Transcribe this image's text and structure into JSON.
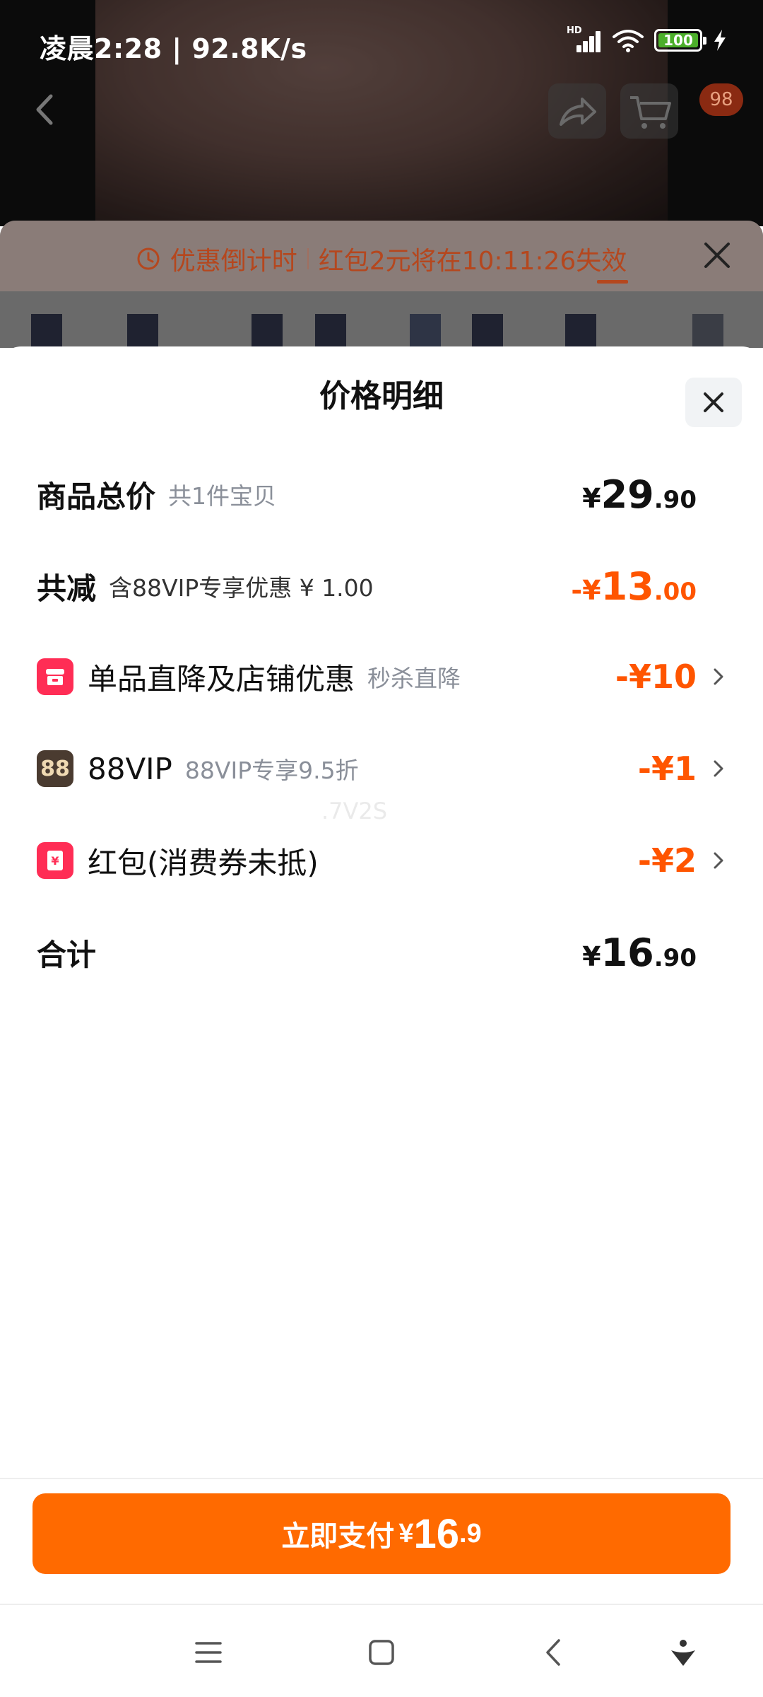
{
  "status_bar": {
    "time": "凌晨2:28 | 92.8K/s",
    "battery": "100",
    "signal_label": "HD"
  },
  "header": {
    "cart_badge": "98"
  },
  "promo": {
    "countdown_label": "优惠倒计时",
    "message": "红包2元将在10:11:26失效"
  },
  "sheet": {
    "title": "价格明细",
    "rows": [
      {
        "label": "商品总价",
        "sub": "共1件宝贝",
        "currency": "¥",
        "int": "29",
        "dec": ".90"
      },
      {
        "label": "共减",
        "sub": "含88VIP专享优惠 ¥ 1.00",
        "currency": "-¥",
        "int": "13",
        "dec": ".00"
      },
      {
        "icon": "shop-icon",
        "label": "单品直降及店铺优惠",
        "sub": "秒杀直降",
        "amount": "-¥10"
      },
      {
        "icon": "88vip-icon",
        "icon_text": "88",
        "label": "88VIP",
        "sub": "88VIP专享9.5折",
        "amount": "-¥1"
      },
      {
        "icon": "red-packet-icon",
        "label": "红包(消费券未抵)",
        "amount": "-¥2"
      },
      {
        "label": "合计",
        "currency": "¥",
        "int": "16",
        "dec": ".90"
      }
    ],
    "watermark": ".7V2S"
  },
  "pay": {
    "label": "立即支付",
    "currency": "¥",
    "int": "16",
    "dec": ".9"
  },
  "colors": {
    "accent": "#ff6a00",
    "discount": "#ff5500",
    "tag_red": "#ff2d55"
  }
}
